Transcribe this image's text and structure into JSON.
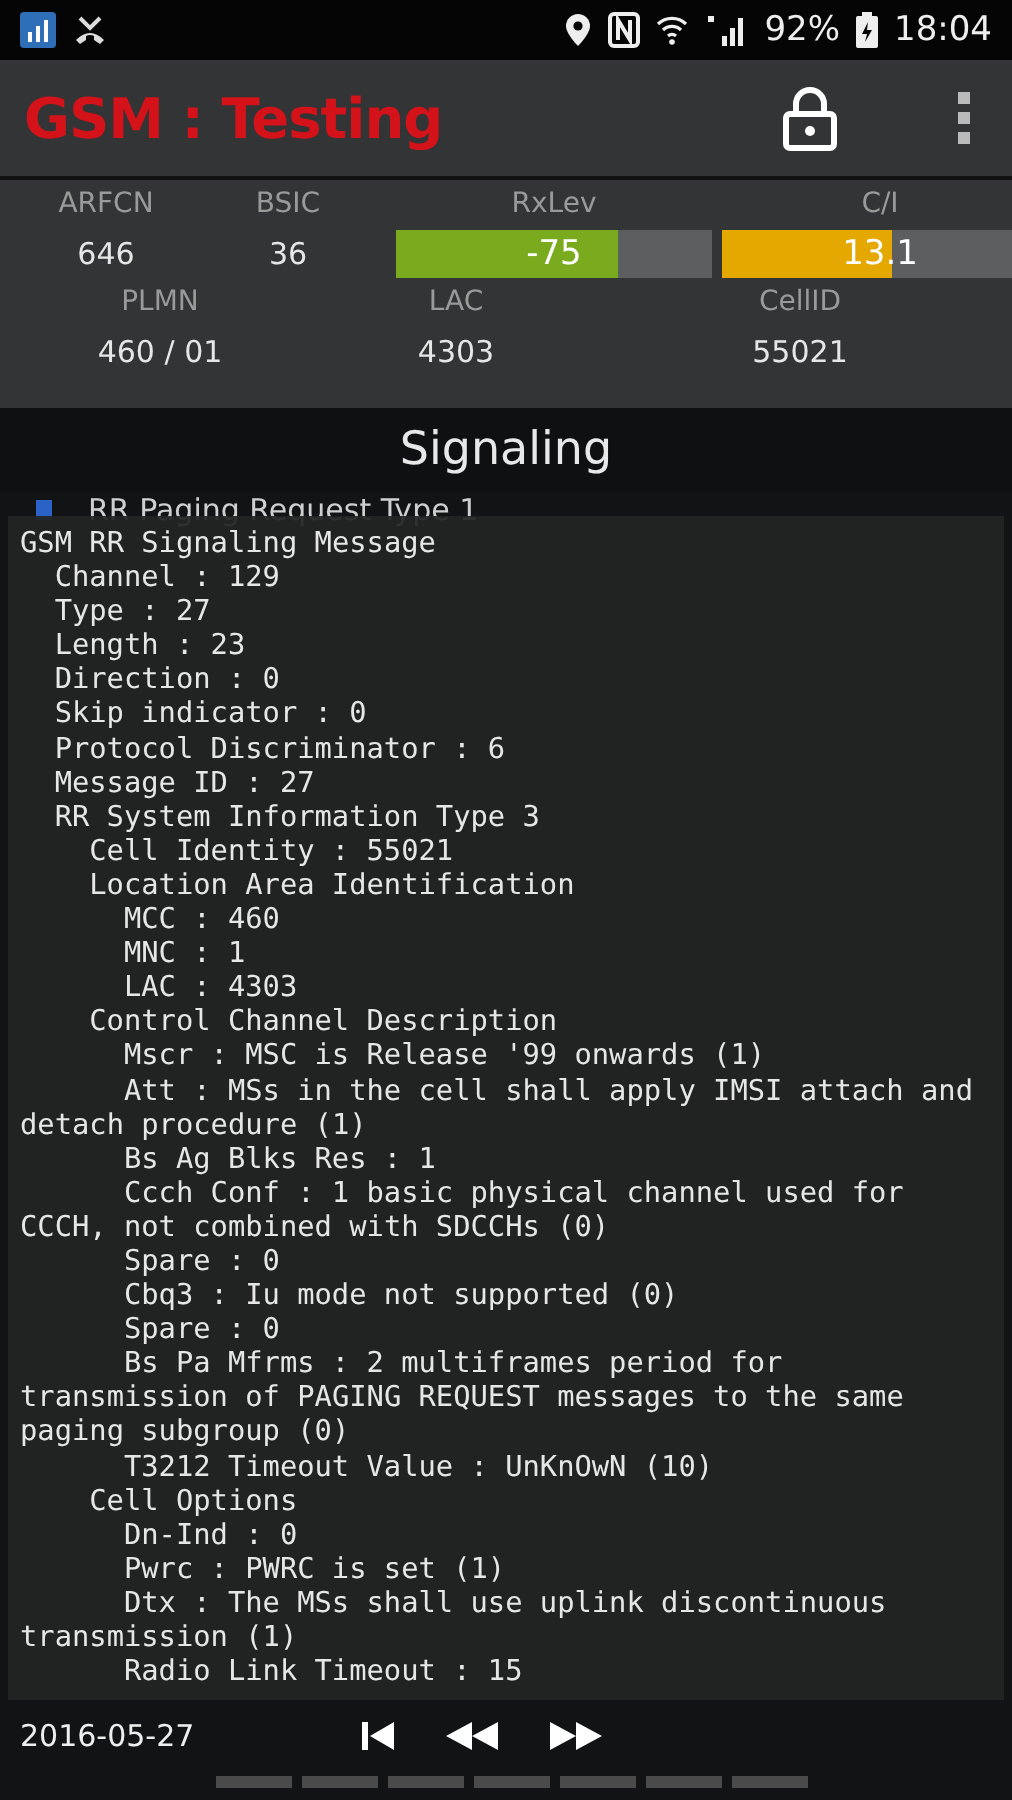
{
  "status_bar": {
    "battery": "92%",
    "time": "18:04"
  },
  "app_bar": {
    "title": "GSM : Testing"
  },
  "cell_info": {
    "top": [
      {
        "kind": "text",
        "label": "ARFCN",
        "value": "646"
      },
      {
        "kind": "text",
        "label": "BSIC",
        "value": "36"
      },
      {
        "kind": "bar",
        "label": "RxLev",
        "value": "-75",
        "level": 0.7,
        "color": "#7aab1e"
      },
      {
        "kind": "bar",
        "label": "C/I",
        "value": "13.1",
        "level": 0.54,
        "color": "#e5a800"
      }
    ],
    "bottom": [
      {
        "label": "PLMN",
        "value": "460 / 01"
      },
      {
        "label": "LAC",
        "value": "4303"
      },
      {
        "label": "CellID",
        "value": "55021"
      }
    ]
  },
  "section_title": "Signaling",
  "list": [
    {
      "title": "RR Paging Request Type 1"
    }
  ],
  "message": {
    "title": "GSM RR Signaling Message",
    "children": [
      {
        "text": "Channel : 129"
      },
      {
        "text": "Type : 27"
      },
      {
        "text": "Length : 23"
      },
      {
        "text": "Direction : 0"
      },
      {
        "text": "Skip indicator : 0"
      },
      {
        "text": "Protocol Discriminator : 6"
      },
      {
        "text": "Message ID : 27"
      },
      {
        "text": "RR System Information Type 3",
        "children": [
          {
            "text": "Cell Identity : 55021"
          },
          {
            "text": "Location Area Identification",
            "children": [
              {
                "text": "MCC : 460"
              },
              {
                "text": "MNC : 1"
              },
              {
                "text": "LAC : 4303"
              }
            ]
          },
          {
            "text": "Control Channel Description",
            "children": [
              {
                "text": "Mscr : MSC is Release '99 onwards (1)"
              },
              {
                "text": "Att : MSs in the cell shall apply IMSI attach and detach procedure (1)"
              },
              {
                "text": "Bs Ag Blks Res : 1"
              },
              {
                "text": "Ccch Conf : 1 basic physical channel used for CCCH, not combined with SDCCHs (0)"
              },
              {
                "text": "Spare : 0"
              },
              {
                "text": "Cbq3 : Iu mode not supported (0)"
              },
              {
                "text": "Spare : 0"
              },
              {
                "text": "Bs Pa Mfrms : 2 multiframes period for transmission of PAGING REQUEST messages to the same paging subgroup (0)"
              },
              {
                "text": "T3212 Timeout Value : UnKnOwN (10)"
              }
            ]
          },
          {
            "text": "Cell Options",
            "children": [
              {
                "text": "Dn-Ind : 0"
              },
              {
                "text": "Pwrc : PWRC is set (1)"
              },
              {
                "text": "Dtx : The MSs shall use uplink discontinuous transmission (1)"
              },
              {
                "text": "Radio Link Timeout : 15"
              }
            ]
          }
        ]
      }
    ]
  },
  "footer": {
    "date": "2016-05-27"
  }
}
